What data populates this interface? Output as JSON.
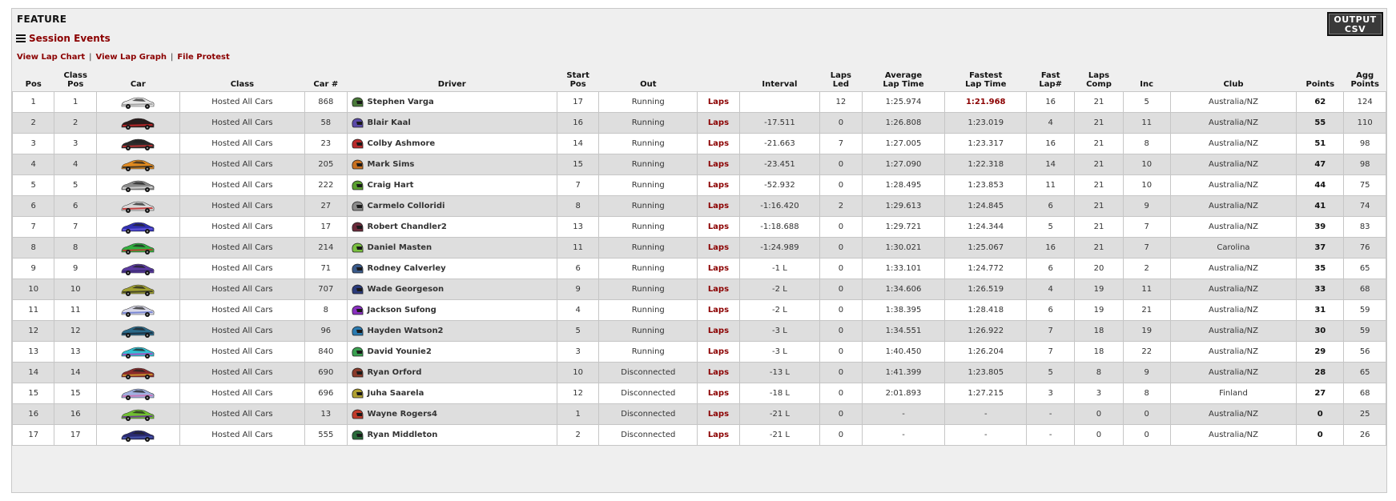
{
  "header": {
    "title": "FEATURE",
    "session_events": "Session Events",
    "links": [
      "View Lap Chart",
      "View Lap Graph",
      "File Protest"
    ],
    "output_csv": "OUTPUT\nCSV"
  },
  "columns": [
    "Pos",
    "Class Pos",
    "Car",
    "Class",
    "Car #",
    "Driver",
    "Start\nPos",
    "Out",
    "",
    "Interval",
    "Laps\nLed",
    "Average\nLap Time",
    "Fastest\nLap Time",
    "Fast\nLap#",
    "Laps\nComp",
    "Inc",
    "Club",
    "Points",
    "Agg\nPoints"
  ],
  "rows": [
    {
      "pos": "1",
      "class_pos": "1",
      "car_color": "#e8e8e8",
      "car_accent": "#9a9a9a",
      "class": "Hosted All Cars",
      "car_num": "868",
      "helmet": "#4a7a3a",
      "driver": "Stephen Varga",
      "start": "17",
      "out": "Running",
      "laps": "Laps",
      "interval": "",
      "led": "12",
      "avg": "1:25.974",
      "fast": "1:21.968",
      "fast_lap": "16",
      "comp": "21",
      "inc": "5",
      "club": "Australia/NZ",
      "points": "62",
      "agg": "124",
      "fast_highlight": true
    },
    {
      "pos": "2",
      "class_pos": "2",
      "car_color": "#2a1a1a",
      "car_accent": "#d0282a",
      "class": "Hosted All Cars",
      "car_num": "58",
      "helmet": "#5a4aa8",
      "driver": "Blair Kaal",
      "start": "16",
      "out": "Running",
      "laps": "Laps",
      "interval": "-17.511",
      "led": "0",
      "avg": "1:26.808",
      "fast": "1:23.019",
      "fast_lap": "4",
      "comp": "21",
      "inc": "11",
      "club": "Australia/NZ",
      "points": "55",
      "agg": "110"
    },
    {
      "pos": "3",
      "class_pos": "3",
      "car_color": "#2a2a2a",
      "car_accent": "#c83030",
      "class": "Hosted All Cars",
      "car_num": "23",
      "helmet": "#b82a2a",
      "driver": "Colby Ashmore",
      "start": "14",
      "out": "Running",
      "laps": "Laps",
      "interval": "-21.663",
      "led": "7",
      "avg": "1:27.005",
      "fast": "1:23.317",
      "fast_lap": "16",
      "comp": "21",
      "inc": "8",
      "club": "Australia/NZ",
      "points": "51",
      "agg": "98"
    },
    {
      "pos": "4",
      "class_pos": "4",
      "car_color": "#e08a20",
      "car_accent": "#2a2a2a",
      "class": "Hosted All Cars",
      "car_num": "205",
      "helmet": "#c87020",
      "driver": "Mark Sims",
      "start": "15",
      "out": "Running",
      "laps": "Laps",
      "interval": "-23.451",
      "led": "0",
      "avg": "1:27.090",
      "fast": "1:22.318",
      "fast_lap": "14",
      "comp": "21",
      "inc": "10",
      "club": "Australia/NZ",
      "points": "47",
      "agg": "98"
    },
    {
      "pos": "5",
      "class_pos": "5",
      "car_color": "#8a8a8a",
      "car_accent": "#d8d8d8",
      "class": "Hosted All Cars",
      "car_num": "222",
      "helmet": "#5aa030",
      "driver": "Craig Hart",
      "start": "7",
      "out": "Running",
      "laps": "Laps",
      "interval": "-52.932",
      "led": "0",
      "avg": "1:28.495",
      "fast": "1:23.853",
      "fast_lap": "11",
      "comp": "21",
      "inc": "10",
      "club": "Australia/NZ",
      "points": "44",
      "agg": "75"
    },
    {
      "pos": "6",
      "class_pos": "6",
      "car_color": "#d8d8d8",
      "car_accent": "#c02828",
      "class": "Hosted All Cars",
      "car_num": "27",
      "helmet": "#8a8a8a",
      "driver": "Carmelo Colloridi",
      "start": "8",
      "out": "Running",
      "laps": "Laps",
      "interval": "-1:16.420",
      "led": "2",
      "avg": "1:29.613",
      "fast": "1:24.845",
      "fast_lap": "6",
      "comp": "21",
      "inc": "9",
      "club": "Australia/NZ",
      "points": "41",
      "agg": "74"
    },
    {
      "pos": "7",
      "class_pos": "7",
      "car_color": "#3030b0",
      "car_accent": "#6a5ae0",
      "class": "Hosted All Cars",
      "car_num": "17",
      "helmet": "#6a2a3a",
      "driver": "Robert Chandler2",
      "start": "13",
      "out": "Running",
      "laps": "Laps",
      "interval": "-1:18.688",
      "led": "0",
      "avg": "1:29.721",
      "fast": "1:24.344",
      "fast_lap": "5",
      "comp": "21",
      "inc": "7",
      "club": "Australia/NZ",
      "points": "39",
      "agg": "83"
    },
    {
      "pos": "8",
      "class_pos": "8",
      "car_color": "#30b040",
      "car_accent": "#c83030",
      "class": "Hosted All Cars",
      "car_num": "214",
      "helmet": "#7ac040",
      "driver": "Daniel Masten",
      "start": "11",
      "out": "Running",
      "laps": "Laps",
      "interval": "-1:24.989",
      "led": "0",
      "avg": "1:30.021",
      "fast": "1:25.067",
      "fast_lap": "16",
      "comp": "21",
      "inc": "7",
      "club": "Carolina",
      "points": "37",
      "agg": "76"
    },
    {
      "pos": "9",
      "class_pos": "9",
      "car_color": "#5a3aa0",
      "car_accent": "#3a2a70",
      "class": "Hosted All Cars",
      "car_num": "71",
      "helmet": "#3a5a8a",
      "driver": "Rodney Calverley",
      "start": "6",
      "out": "Running",
      "laps": "Laps",
      "interval": "-1 L",
      "led": "0",
      "avg": "1:33.101",
      "fast": "1:24.772",
      "fast_lap": "6",
      "comp": "20",
      "inc": "2",
      "club": "Australia/NZ",
      "points": "35",
      "agg": "65"
    },
    {
      "pos": "10",
      "class_pos": "10",
      "car_color": "#a0a030",
      "car_accent": "#3a3a2a",
      "class": "Hosted All Cars",
      "car_num": "707",
      "helmet": "#2a3a7a",
      "driver": "Wade Georgeson",
      "start": "9",
      "out": "Running",
      "laps": "Laps",
      "interval": "-2 L",
      "led": "0",
      "avg": "1:34.606",
      "fast": "1:26.519",
      "fast_lap": "4",
      "comp": "19",
      "inc": "11",
      "club": "Australia/NZ",
      "points": "33",
      "agg": "68"
    },
    {
      "pos": "11",
      "class_pos": "11",
      "car_color": "#d8d8e8",
      "car_accent": "#6a7ad0",
      "class": "Hosted All Cars",
      "car_num": "8",
      "helmet": "#8a30c0",
      "driver": "Jackson Sufong",
      "start": "4",
      "out": "Running",
      "laps": "Laps",
      "interval": "-2 L",
      "led": "0",
      "avg": "1:38.395",
      "fast": "1:28.418",
      "fast_lap": "6",
      "comp": "19",
      "inc": "21",
      "club": "Australia/NZ",
      "points": "31",
      "agg": "59"
    },
    {
      "pos": "12",
      "class_pos": "12",
      "car_color": "#2a6a8a",
      "car_accent": "#1a2a3a",
      "class": "Hosted All Cars",
      "car_num": "96",
      "helmet": "#2a7ab0",
      "driver": "Hayden Watson2",
      "start": "5",
      "out": "Running",
      "laps": "Laps",
      "interval": "-3 L",
      "led": "0",
      "avg": "1:34.551",
      "fast": "1:26.922",
      "fast_lap": "7",
      "comp": "18",
      "inc": "19",
      "club": "Australia/NZ",
      "points": "30",
      "agg": "59"
    },
    {
      "pos": "13",
      "class_pos": "13",
      "car_color": "#30c0d0",
      "car_accent": "#b040c0",
      "class": "Hosted All Cars",
      "car_num": "840",
      "helmet": "#3aa050",
      "driver": "David Younie2",
      "start": "3",
      "out": "Running",
      "laps": "Laps",
      "interval": "-3 L",
      "led": "0",
      "avg": "1:40.450",
      "fast": "1:26.204",
      "fast_lap": "7",
      "comp": "18",
      "inc": "22",
      "club": "Australia/NZ",
      "points": "29",
      "agg": "56"
    },
    {
      "pos": "14",
      "class_pos": "14",
      "car_color": "#8a2a2a",
      "car_accent": "#d0a030",
      "class": "Hosted All Cars",
      "car_num": "690",
      "helmet": "#8a3a2a",
      "driver": "Ryan Orford",
      "start": "10",
      "out": "Disconnected",
      "laps": "Laps",
      "interval": "-13 L",
      "led": "0",
      "avg": "1:41.399",
      "fast": "1:23.805",
      "fast_lap": "5",
      "comp": "8",
      "inc": "9",
      "club": "Australia/NZ",
      "points": "28",
      "agg": "65"
    },
    {
      "pos": "15",
      "class_pos": "15",
      "car_color": "#a0b0e0",
      "car_accent": "#d070b0",
      "class": "Hosted All Cars",
      "car_num": "696",
      "helmet": "#b0a030",
      "driver": "Juha Saarela",
      "start": "12",
      "out": "Disconnected",
      "laps": "Laps",
      "interval": "-18 L",
      "led": "0",
      "avg": "2:01.893",
      "fast": "1:27.215",
      "fast_lap": "3",
      "comp": "3",
      "inc": "8",
      "club": "Finland",
      "points": "27",
      "agg": "68"
    },
    {
      "pos": "16",
      "class_pos": "16",
      "car_color": "#70c030",
      "car_accent": "#6a2aa0",
      "class": "Hosted All Cars",
      "car_num": "13",
      "helmet": "#c03a2a",
      "driver": "Wayne Rogers4",
      "start": "1",
      "out": "Disconnected",
      "laps": "Laps",
      "interval": "-21 L",
      "led": "0",
      "avg": "-",
      "fast": "-",
      "fast_lap": "-",
      "comp": "0",
      "inc": "0",
      "club": "Australia/NZ",
      "points": "0",
      "agg": "25"
    },
    {
      "pos": "17",
      "class_pos": "17",
      "car_color": "#2a2a70",
      "car_accent": "#4a5ab0",
      "class": "Hosted All Cars",
      "car_num": "555",
      "helmet": "#2a6a3a",
      "driver": "Ryan Middleton",
      "start": "2",
      "out": "Disconnected",
      "laps": "Laps",
      "interval": "-21 L",
      "led": "0",
      "avg": "-",
      "fast": "-",
      "fast_lap": "-",
      "comp": "0",
      "inc": "0",
      "club": "Australia/NZ",
      "points": "0",
      "agg": "26"
    }
  ]
}
